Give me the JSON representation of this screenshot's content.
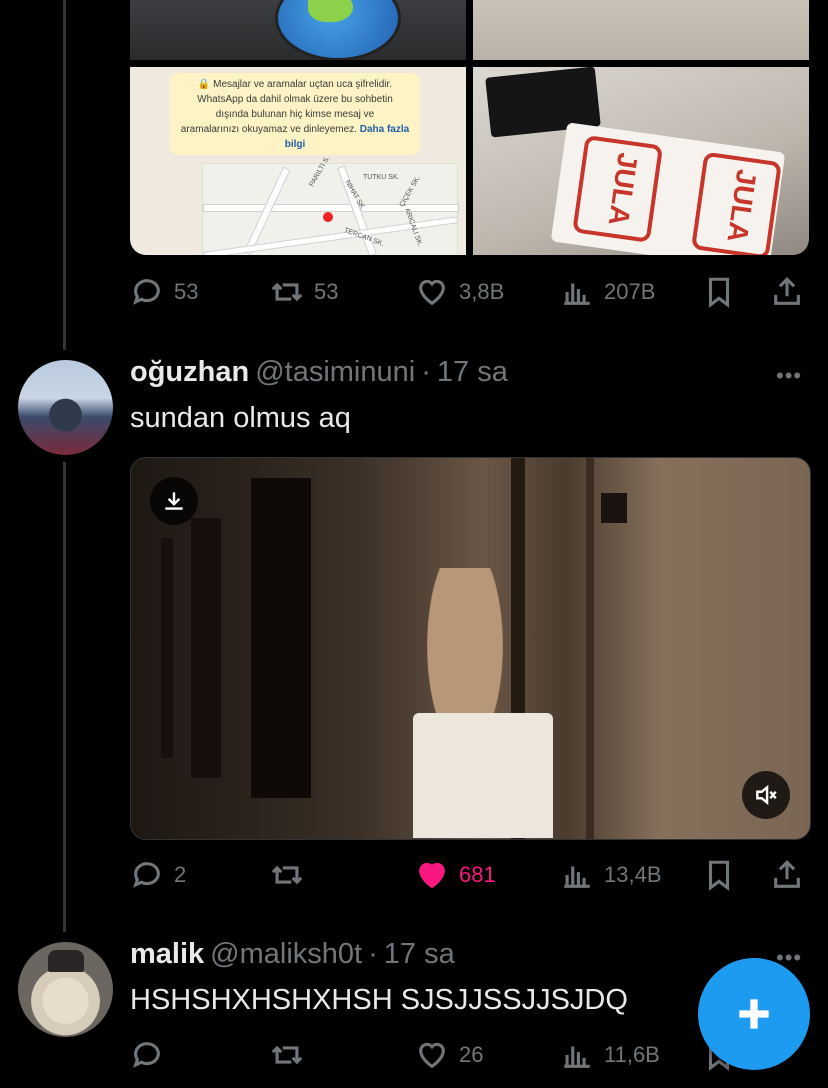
{
  "top_tweet": {
    "whatsapp_banner": {
      "line1": "Mesajlar ve aramalar uçtan uca şifrelidir.",
      "line2": "WhatsApp da dahil olmak üzere bu sohbetin",
      "line3": "dışında bulunan hiç kimse mesaj ve",
      "line4": "aramalarınızı okuyamaz ve dinleyemez.",
      "link": "Daha fazla bilgi"
    },
    "map_labels": [
      "TUTKU SK.",
      "PARILTI S.",
      "NİHAT SK.",
      "ÇİÇEK SK.",
      "TERCAN SK.",
      "ARICALI SK."
    ],
    "bag_brand": "JULA",
    "actions": {
      "replies": "53",
      "reposts": "53",
      "likes": "3,8B",
      "views": "207B"
    }
  },
  "tweet2": {
    "name": "oğuzhan",
    "handle": "@tasiminuni",
    "separator": "·",
    "time": "17 sa",
    "text": "sundan olmus aq",
    "actions": {
      "replies": "2",
      "reposts": "",
      "likes": "681",
      "views": "13,4B"
    }
  },
  "tweet3": {
    "name": "malik",
    "handle": "@maliksh0t",
    "separator": "·",
    "time": "17 sa",
    "text": "HSHSHXHSHXHSH SJSJJSSJJSJDQ",
    "actions": {
      "replies": "",
      "reposts": "",
      "likes": "26",
      "views": "11,6B"
    }
  },
  "more_label": "•••",
  "colors": {
    "background": "#000000",
    "like_active": "#f91880",
    "fab": "#1d9bf0",
    "muted": "#71767b"
  }
}
